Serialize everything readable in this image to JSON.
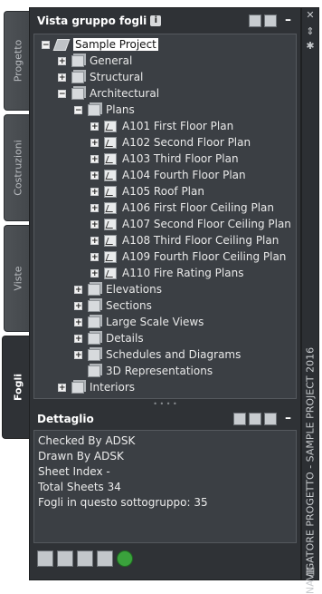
{
  "tabs": [
    {
      "label": "Progetto",
      "active": false
    },
    {
      "label": "Costruzioni",
      "active": false
    },
    {
      "label": "Viste",
      "active": false
    },
    {
      "label": "Fogli",
      "active": true
    }
  ],
  "sheet_panel": {
    "title": "Vista gruppo fogli",
    "info_icon_label": "i",
    "collapse_label": "–"
  },
  "tree": [
    {
      "label": "Sample Project",
      "icon": "sheetset-icon",
      "expander": "minus"
    },
    {
      "label": "General",
      "icon": "group-icon",
      "expander": "plus"
    },
    {
      "label": "Structural",
      "icon": "group-icon",
      "expander": "plus"
    },
    {
      "label": "Architectural",
      "icon": "group-icon",
      "expander": "minus"
    },
    {
      "label": "Plans",
      "icon": "group-icon",
      "expander": "minus"
    },
    {
      "label": "A101 First Floor Plan",
      "icon": "sheet-icon",
      "expander": "plus"
    },
    {
      "label": "A102 Second Floor Plan",
      "icon": "sheet-icon",
      "expander": "plus"
    },
    {
      "label": "A103 Third Floor Plan",
      "icon": "sheet-icon",
      "expander": "plus"
    },
    {
      "label": "A104 Fourth Floor Plan",
      "icon": "sheet-icon",
      "expander": "plus"
    },
    {
      "label": "A105 Roof Plan",
      "icon": "sheet-icon",
      "expander": "plus"
    },
    {
      "label": "A106 First Floor Ceiling Plan",
      "icon": "sheet-icon",
      "expander": "plus"
    },
    {
      "label": "A107 Second Floor Ceiling Plan",
      "icon": "sheet-icon",
      "expander": "plus"
    },
    {
      "label": "A108 Third Floor Ceiling Plan",
      "icon": "sheet-icon",
      "expander": "plus"
    },
    {
      "label": "A109 Fourth Floor Ceiling Plan",
      "icon": "sheet-icon",
      "expander": "plus"
    },
    {
      "label": "A110 Fire Rating Plans",
      "icon": "sheet-icon",
      "expander": "plus"
    },
    {
      "label": "Elevations",
      "icon": "group-icon",
      "expander": "plus"
    },
    {
      "label": "Sections",
      "icon": "group-icon",
      "expander": "plus"
    },
    {
      "label": "Large Scale Views",
      "icon": "group-icon",
      "expander": "plus"
    },
    {
      "label": "Details",
      "icon": "group-icon",
      "expander": "plus"
    },
    {
      "label": "Schedules and Diagrams",
      "icon": "group-icon",
      "expander": "plus"
    },
    {
      "label": "3D Representations",
      "icon": "group-icon",
      "expander": "none"
    },
    {
      "label": "Interiors",
      "icon": "group-icon",
      "expander": "plus"
    }
  ],
  "details_panel": {
    "title": "Dettaglio",
    "collapse_label": "–",
    "lines": [
      "Checked By ADSK",
      "Drawn By ADSK",
      "Sheet Index -",
      "Total Sheets 34",
      "Fogli in questo sottogruppo: 35"
    ]
  },
  "bottom_toolbar": [
    "globe-icon",
    "new-sheet-icon",
    "view-sheet-icon",
    "sheet-list-icon",
    "refresh-icon"
  ],
  "window_title": "NAVIGATORE PROGETTO - SAMPLE PROJECT 2016",
  "colors": {
    "panel_bg": "#2f3236",
    "tree_bg": "#3b3f44",
    "selection_bg": "#ffffff"
  }
}
